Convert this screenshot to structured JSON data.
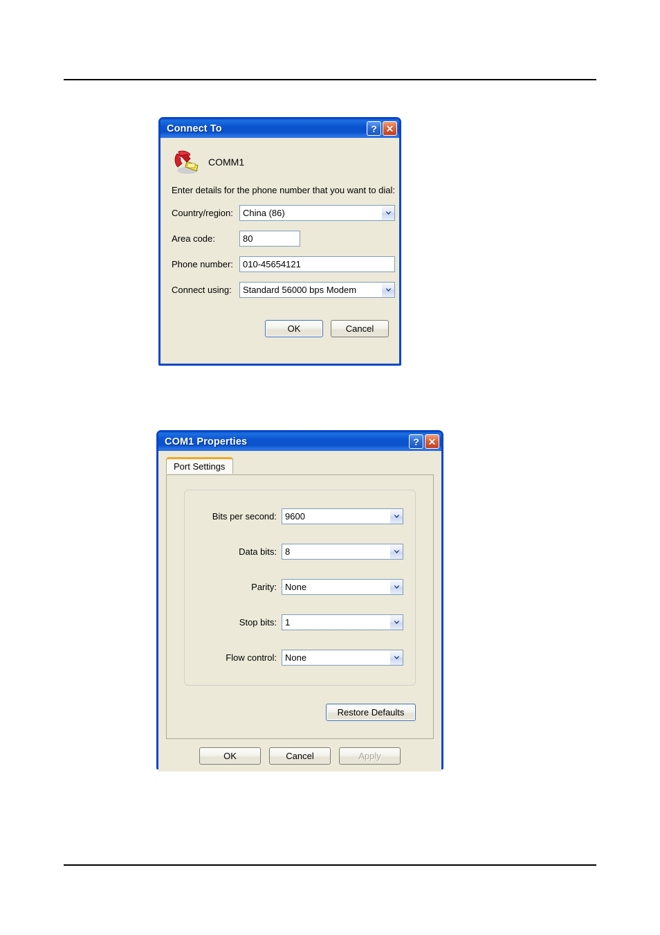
{
  "page": {
    "header_rule": "horizontal-rule",
    "footer_rule": "horizontal-rule"
  },
  "connect_dialog": {
    "title": "Connect To",
    "help_button": "?",
    "close_button": "✕",
    "connection_name": "COMM1",
    "icon": "telephone-icon",
    "instructions": "Enter details for the phone number that you want to dial:",
    "fields": [
      {
        "label": "Country/region:",
        "value": "China (86)",
        "type": "combo"
      },
      {
        "label": "Area code:",
        "value": "80",
        "type": "text"
      },
      {
        "label": "Phone number:",
        "value": "010-45654121",
        "type": "text"
      },
      {
        "label": "Connect using:",
        "value": "Standard 56000 bps Modem",
        "type": "combo"
      }
    ],
    "buttons": {
      "ok": "OK",
      "cancel": "Cancel"
    }
  },
  "com1_dialog": {
    "title": "COM1 Properties",
    "help_button": "?",
    "close_button": "✕",
    "tabs": [
      {
        "label": "Port Settings",
        "active": true
      }
    ],
    "settings": [
      {
        "label": "Bits per second:",
        "value": "9600"
      },
      {
        "label": "Data bits:",
        "value": "8"
      },
      {
        "label": "Parity:",
        "value": "None"
      },
      {
        "label": "Stop bits:",
        "value": "1"
      },
      {
        "label": "Flow control:",
        "value": "None"
      }
    ],
    "restore_defaults": "Restore Defaults",
    "buttons": {
      "ok": "OK",
      "cancel": "Cancel",
      "apply": "Apply",
      "apply_disabled": true
    }
  },
  "colors": {
    "titlebar_blue": "#0a54cf",
    "dialog_face": "#ece9d8",
    "tab_accent_orange": "#f0a726",
    "close_red": "#c83d1b",
    "input_border": "#7f9db9",
    "disabled_text": "#aca899"
  }
}
